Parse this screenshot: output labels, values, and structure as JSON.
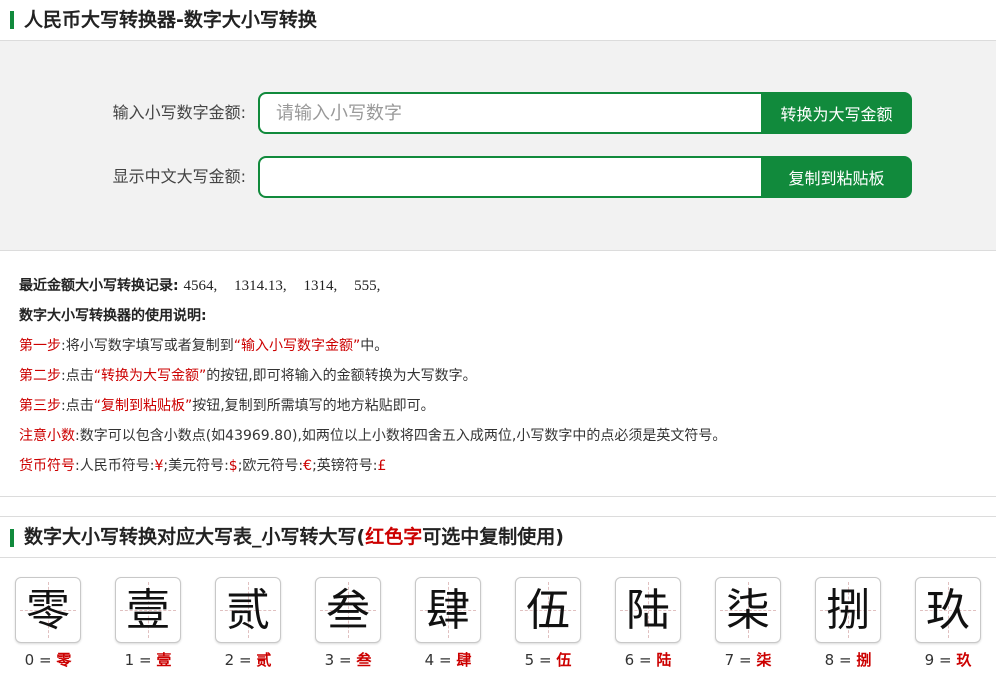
{
  "header": {
    "title": "人民币大写转换器-数字大小写转换"
  },
  "converter": {
    "input_label": "输入小写数字金额:",
    "input_placeholder": "请输入小写数字",
    "input_value": "",
    "convert_button": "转换为大写金额",
    "output_label": "显示中文大写金额:",
    "output_value": "",
    "copy_button": "复制到粘贴板"
  },
  "info": {
    "records_label": "最近金额大小写转换记录:",
    "records": [
      "4564,",
      "1314.13,",
      "1314,",
      "555,"
    ],
    "usage_title": "数字大小写转换器的使用说明:",
    "step1": {
      "label": "第一步",
      "pre": ":将小写数字填写或者复制到",
      "highlight": "“输入小写数字金额”",
      "post": "中。"
    },
    "step2": {
      "label": "第二步",
      "pre": ":点击",
      "highlight": "“转换为大写金额”",
      "post": "的按钮,即可将输入的金额转换为大写数字。"
    },
    "step3": {
      "label": "第三步",
      "pre": ":点击",
      "highlight": "“复制到粘贴板”",
      "post": "按钮,复制到所需填写的地方粘贴即可。"
    },
    "note": {
      "label": "注意小数",
      "text": ":数字可以包含小数点(如43969.80),如两位以上小数将四舍五入成两位,小写数字中的点必须是英文符号。"
    },
    "currency": {
      "label": "货币符号",
      "rmb_label": ":人民币符号:",
      "rmb_sym": "¥",
      "usd_label": ";美元符号:",
      "usd_sym": "$",
      "eur_label": ";欧元符号:",
      "eur_sym": "€",
      "gbp_label": ";英镑符号:",
      "gbp_sym": "£"
    }
  },
  "table": {
    "title_pre": "数字大小写转换对应大写表_小写转大写(",
    "title_red": "红色字",
    "title_post": "可选中复制使用)",
    "cards": [
      {
        "glyph": "零",
        "num": "0",
        "eq": "=",
        "upper": "零"
      },
      {
        "glyph": "壹",
        "num": "1",
        "eq": "=",
        "upper": "壹"
      },
      {
        "glyph": "贰",
        "num": "2",
        "eq": "=",
        "upper": "贰"
      },
      {
        "glyph": "叁",
        "num": "3",
        "eq": "=",
        "upper": "叁"
      },
      {
        "glyph": "肆",
        "num": "4",
        "eq": "=",
        "upper": "肆"
      },
      {
        "glyph": "伍",
        "num": "5",
        "eq": "=",
        "upper": "伍"
      },
      {
        "glyph": "陆",
        "num": "6",
        "eq": "=",
        "upper": "陆"
      },
      {
        "glyph": "柒",
        "num": "7",
        "eq": "=",
        "upper": "柒"
      },
      {
        "glyph": "捌",
        "num": "8",
        "eq": "=",
        "upper": "捌"
      },
      {
        "glyph": "玖",
        "num": "9",
        "eq": "=",
        "upper": "玖"
      }
    ]
  },
  "colors": {
    "accent": "#118a3c",
    "highlight": "#cc0000"
  }
}
